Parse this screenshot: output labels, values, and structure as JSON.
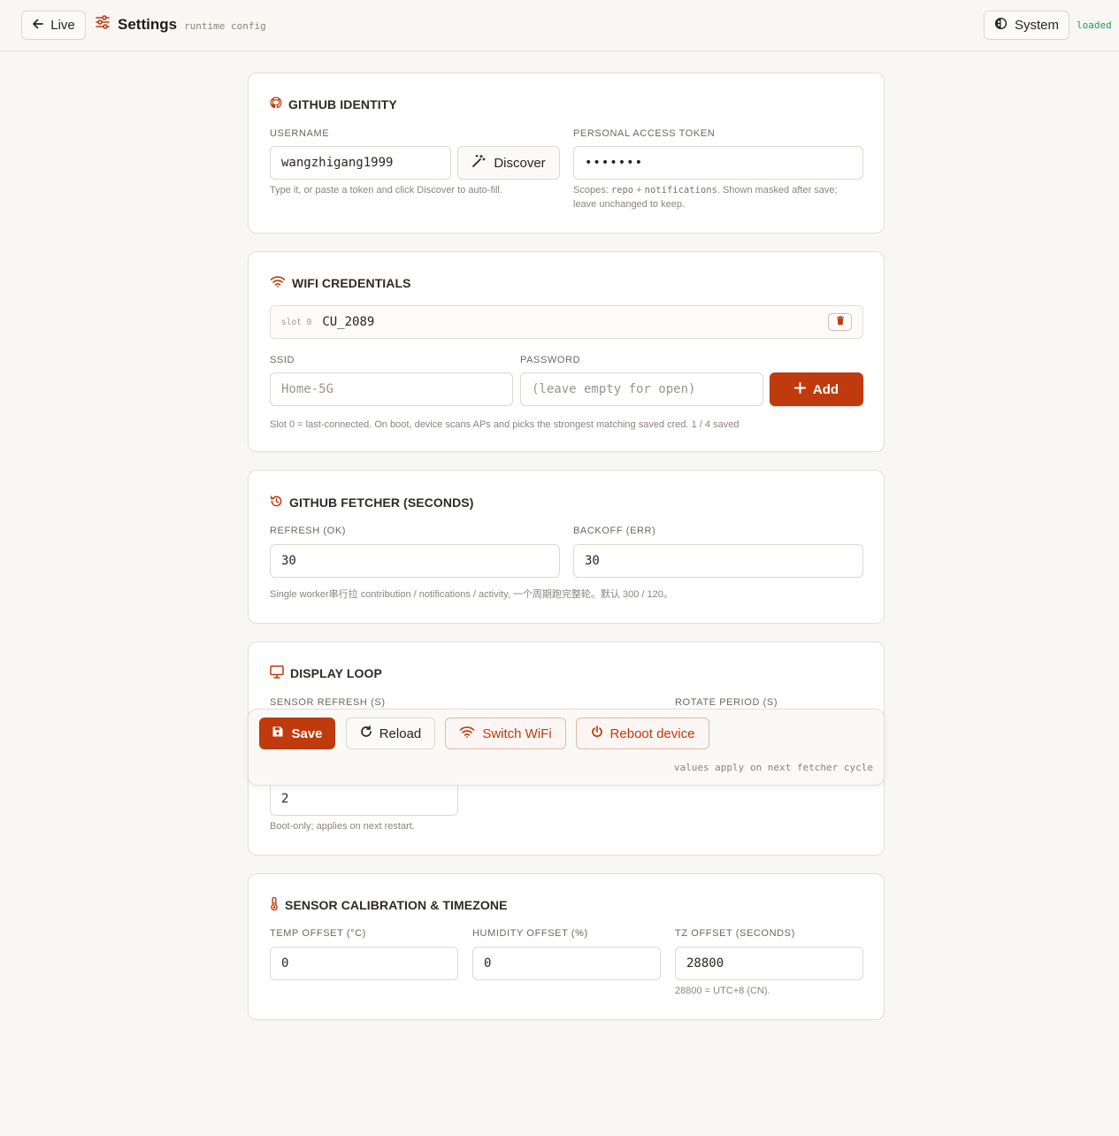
{
  "topbar": {
    "back_label": "Live",
    "title": "Settings",
    "subtitle": "runtime config",
    "theme_label": "System",
    "status": "loaded",
    "status_color": "#1f9a55"
  },
  "accent_color": "#bf3a0c",
  "github_identity": {
    "heading": "GITHUB IDENTITY",
    "username_label": "USERNAME",
    "username_value": "wangzhigang1999",
    "discover_label": "Discover",
    "username_help": "Type it, or paste a token and click Discover to auto-fill.",
    "token_label": "PERSONAL ACCESS TOKEN",
    "token_value": "•••••••",
    "token_help_1": "Scopes: ",
    "token_help_code_1": "repo",
    "token_help_2": " + ",
    "token_help_code_2": "notifications",
    "token_help_3": ". Shown masked after save;",
    "token_help_4": "leave unchanged to keep."
  },
  "wifi": {
    "heading": "WIFI CREDENTIALS",
    "slots": [
      {
        "tag": "slot 0",
        "ssid": "CU_2089"
      }
    ],
    "ssid_label": "SSID",
    "ssid_placeholder": "Home-5G",
    "password_label": "PASSWORD",
    "password_placeholder": "(leave empty for open)",
    "add_label": "Add",
    "help": "Slot 0 = last-connected. On boot, device scans APs and picks the strongest matching saved cred. 1 / 4 saved"
  },
  "fetcher": {
    "heading": "GITHUB FETCHER (SECONDS)",
    "refresh_label": "REFRESH (OK)",
    "refresh_value": "30",
    "backoff_label": "BACKOFF (ERR)",
    "backoff_value": "30",
    "help": "Single worker串行拉 contribution / notifications / activity, 一个周期跑完整轮。默认 300 / 120。"
  },
  "display_loop": {
    "heading": "DISPLAY LOOP",
    "sensor_refresh_label": "SENSOR REFRESH (S)",
    "rotate_period_label": "ROTATE PERIOD (S)",
    "boot_value": "2",
    "boot_help": "Boot-only; applies on next restart."
  },
  "calibration": {
    "heading": "SENSOR CALIBRATION & TIMEZONE",
    "temp_label": "TEMP OFFSET (°C)",
    "temp_value": "0",
    "humidity_label": "HUMIDITY OFFSET (%)",
    "humidity_value": "0",
    "tz_label": "TZ OFFSET (SECONDS)",
    "tz_value": "28800",
    "tz_help": "28800 = UTC+8 (CN)."
  },
  "actions": {
    "save": "Save",
    "reload": "Reload",
    "switch_wifi": "Switch WiFi",
    "reboot": "Reboot device",
    "note": "values apply on next fetcher cycle"
  }
}
